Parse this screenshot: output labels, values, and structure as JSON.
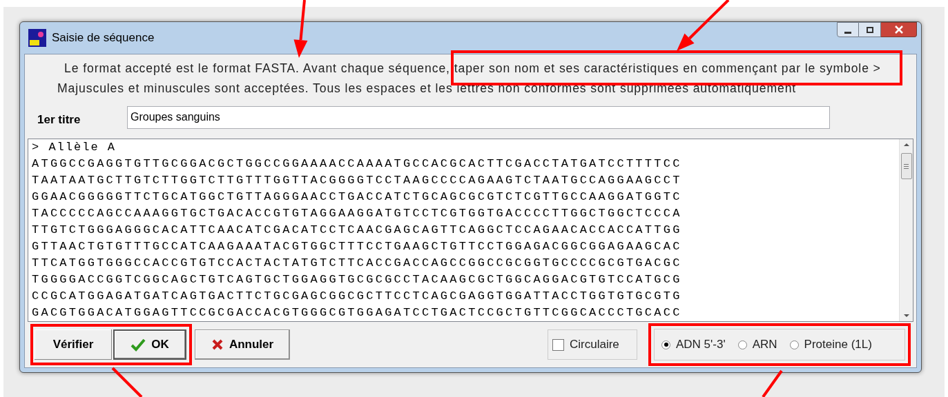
{
  "window": {
    "title": "Saisie de séquence"
  },
  "instructions": [
    "Le format accepté est le format FASTA. Avant chaque séquence, taper son nom et ses caractéristiques en commençant par le symbole >",
    "Majuscules et minuscules sont acceptées. Tous les espaces et les lettres non conformes sont supprimées automatiquement"
  ],
  "title_field": {
    "label": "1er titre",
    "value": "Groupes sanguins"
  },
  "sequence": {
    "header": "> Allèle A",
    "lines": [
      "ATGGCCGAGGTGTTGCGGACGCTGGCCGGAAAACCAAAATGCCACGCACTTCGACCTATGATCCTTTTCC",
      "TAATAATGCTTGTCTTGGTCTTGTTTGGTTACGGGGTCCTAAGCCCCAGAAGTCTAATGCCAGGAAGCCT",
      "GGAACGGGGGTTCTGCATGGCTGTTAGGGAACCTGACCATCTGCAGCGCGTCTCGTTGCCAAGGATGGTC",
      "TACCCCCAGCCAAAGGTGCTGACACCGTGTAGGAAGGATGTCCTCGTGGTGACCCCTTGGCTGGCTCCCA",
      "TTGTCTGGGAGGGCACATTCAACATCGACATCCTCAACGAGCAGTTCAGGCTCCAGAACACCACCATTGG",
      "GTTAACTGTGTTTGCCATCAAGAAATACGTGGCTTTCCTGAAGCTGTTCCTGGAGACGGCGGAGAAGCAC",
      "TTCATGGTGGGCCACCGTGTCCACTACTATGTCTTCACCGACCAGCCGGCCGCGGTGCCCCGCGTGACGC",
      "TGGGGACCGGTCGGCAGCTGTCAGTGCTGGAGGTGCGCGCCTACAAGCGCTGGCAGGACGTGTCCATGCG",
      "CCGCATGGAGATGATCAGTGACTTCTGCGAGCGGCGCTTCCTCAGCGAGGTGGATTACCTGGTGTGCGTG",
      "GACGTGGACATGGAGTTCCGCGACCACGTGGGCGTGGAGATCCTGACTCCGCTGTTCGGCACCCTGCACC"
    ]
  },
  "buttons": [
    {
      "kind": "plain",
      "label": "Vérifier"
    },
    {
      "kind": "ok",
      "label": "OK"
    },
    {
      "kind": "cancel",
      "label": "Annuler"
    }
  ],
  "circular": {
    "label": "Circulaire",
    "checked": false
  },
  "sequence_types": [
    {
      "label": "ADN 5'-3'",
      "selected": true
    },
    {
      "label": "ARN",
      "selected": false
    },
    {
      "label": "Proteine (1L)",
      "selected": false
    }
  ]
}
